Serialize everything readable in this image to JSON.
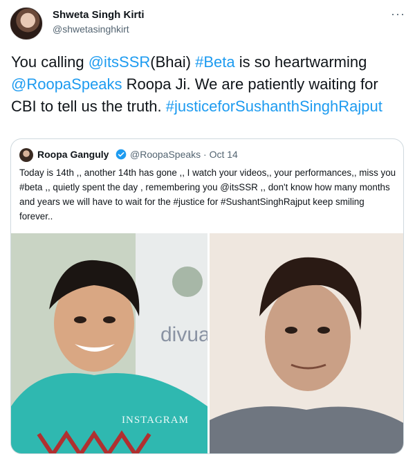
{
  "author": {
    "name": "Shweta Singh Kirti",
    "handle": "@shwetasinghkirt"
  },
  "tweet": {
    "parts": [
      {
        "text": "You calling ",
        "link": false
      },
      {
        "text": "@itsSSR",
        "link": true
      },
      {
        "text": "(Bhai)  ",
        "link": false
      },
      {
        "text": "#Beta",
        "link": true
      },
      {
        "text": " is so heartwarming ",
        "link": false
      },
      {
        "text": "@RoopaSpeaks",
        "link": true
      },
      {
        "text": " Roopa Ji. We are patiently waiting for CBI to tell us the truth. ",
        "link": false
      },
      {
        "text": "#justiceforSushanthSinghRajput",
        "link": true
      }
    ]
  },
  "quote": {
    "name": "Roopa Ganguly",
    "handle": "@RoopaSpeaks · Oct 14",
    "text": "Today is 14th ,, another 14th has gone ,, I watch your videos,, your performances,, miss you #beta ,, quietly spent the day , remembering you @itsSSR ,, don't know how many months and years we will have to wait for the #justice for #SushantSinghRajput keep smiling forever.."
  },
  "photos": {
    "left_watermark": "divua",
    "instagram_mark": "INSTAGRAM"
  },
  "colors": {
    "link": "#1d9bf0",
    "secondary": "#536471",
    "border": "#cfd9de"
  },
  "icons": {
    "more": "more-icon",
    "verified": "verified-badge-icon"
  }
}
